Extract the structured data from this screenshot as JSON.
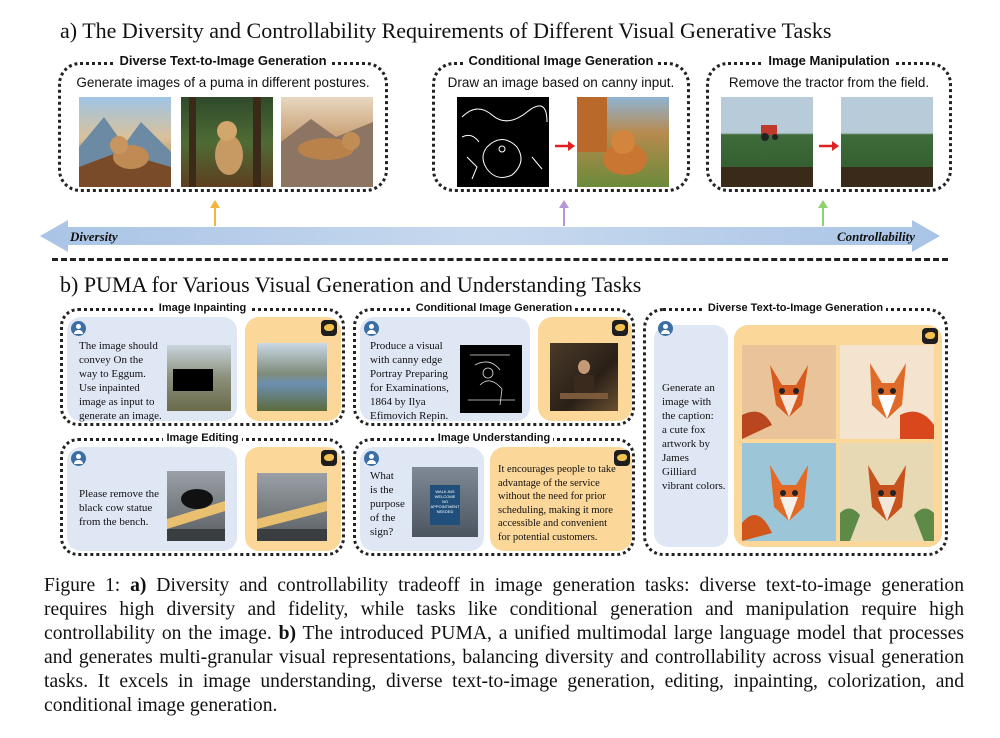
{
  "section_a": {
    "title": "a) The Diversity and Controllability Requirements of Different Visual Generative Tasks",
    "boxes": [
      {
        "label": "Diverse Text-to-Image Generation",
        "prompt": "Generate images of a puma in different postures."
      },
      {
        "label": "Conditional Image Generation",
        "prompt": "Draw an image based on canny input."
      },
      {
        "label": "Image Manipulation",
        "prompt": "Remove the tractor from the field."
      }
    ],
    "axis": {
      "left_label": "Diversity",
      "right_label": "Controllability"
    },
    "colors": {
      "axis": "#b7cde8",
      "arrow_1": "#f2b43a",
      "arrow_2": "#b497d6",
      "arrow_3": "#8fd16b",
      "transform_arrow": "#e02020"
    }
  },
  "section_b": {
    "title": "b) PUMA for Various Visual Generation and Understanding Tasks",
    "panels": {
      "inpainting": {
        "label": "Image Inpainting",
        "prompt_lines": [
          "The image should",
          "convey On the",
          "way to Eggum.",
          "Use inpainted",
          "image as input to",
          "generate an image."
        ]
      },
      "conditional": {
        "label": "Conditional Image Generation",
        "prompt_lines": [
          "Produce a visual",
          "with canny edge",
          "Portray Preparing",
          "for Examinations,",
          "1864  by Ilya",
          "Efimovich Repin."
        ]
      },
      "editing": {
        "label": "Image Editing",
        "prompt_lines": [
          "Please remove the",
          "black cow statue",
          "from the bench."
        ]
      },
      "understanding": {
        "label": "Image Understanding",
        "question_lines": [
          "What",
          "is the",
          "purpose",
          "of the",
          "sign?"
        ],
        "answer_lines": [
          "It encourages people to take",
          "advantage of the service",
          "without the need for prior",
          "scheduling, making it more",
          "accessible and convenient",
          "for potential customers."
        ],
        "sign_text": [
          "WALK-INS",
          "WELCOME",
          "NO APPOINTMENT",
          "NEEDED"
        ]
      },
      "t2i": {
        "label": "Diverse Text-to-Image Generation",
        "prompt_lines": [
          "Generate an",
          "image with",
          "the caption:",
          "a cute fox",
          "artwork by",
          "James",
          "Gilliard",
          "vibrant colors."
        ]
      }
    },
    "colors": {
      "user_panel": "#dfe6f4",
      "model_panel": "#fbd79a",
      "user_icon": "#3a6ea5"
    },
    "icons": [
      "user-avatar-icon",
      "puma-logo-icon"
    ]
  },
  "caption": {
    "prefix": "Figure 1: ",
    "a_marker": "a)",
    "a_text": " Diversity and controllability tradeoff in image generation tasks: diverse text-to-image generation requires high diversity and fidelity, while tasks like conditional generation and manipulation require high controllability on the image. ",
    "b_marker": "b)",
    "b_text": " The introduced PUMA, a unified multimodal large language model that processes and generates multi-granular visual representations, balancing diversity and controllability across visual generation tasks. It excels in image understanding, diverse text-to-image generation, editing, inpainting, colorization, and conditional image generation."
  }
}
